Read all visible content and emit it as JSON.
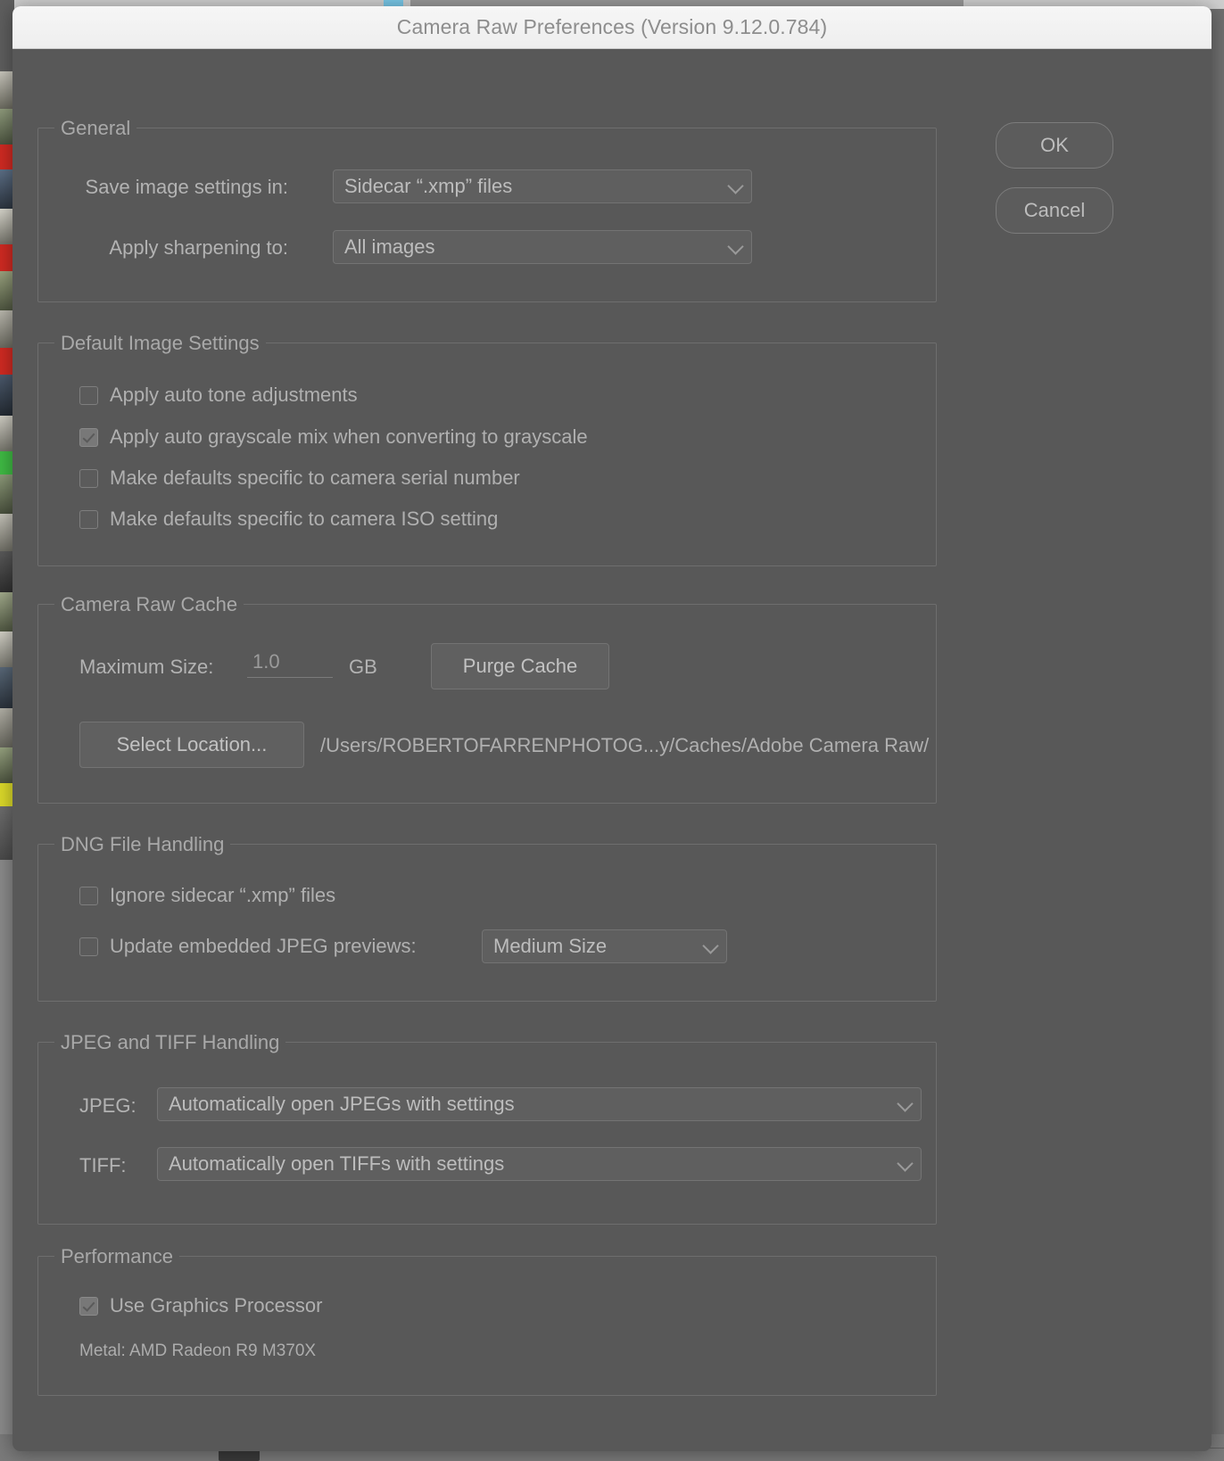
{
  "window": {
    "title": "Camera Raw Preferences  (Version 9.12.0.784)"
  },
  "actions": {
    "ok_label": "OK",
    "cancel_label": "Cancel"
  },
  "general": {
    "legend": "General",
    "save_settings_label": "Save image settings in:",
    "save_settings_value": "Sidecar “.xmp” files",
    "apply_sharpening_label": "Apply sharpening to:",
    "apply_sharpening_value": "All images"
  },
  "default_image_settings": {
    "legend": "Default Image Settings",
    "items": [
      {
        "label": "Apply auto tone adjustments",
        "checked": false
      },
      {
        "label": "Apply auto grayscale mix when converting to grayscale",
        "checked": true
      },
      {
        "label": "Make defaults specific to camera serial number",
        "checked": false
      },
      {
        "label": "Make defaults specific to camera ISO setting",
        "checked": false
      }
    ]
  },
  "camera_raw_cache": {
    "legend": "Camera Raw Cache",
    "max_size_label": "Maximum Size:",
    "max_size_value": "1.0",
    "units_label": "GB",
    "purge_label": "Purge Cache",
    "select_location_label": "Select Location...",
    "cache_path": "/Users/ROBERTOFARRENPHOTOG...y/Caches/Adobe Camera Raw/"
  },
  "dng_file_handling": {
    "legend": "DNG File Handling",
    "ignore_sidecar_label": "Ignore sidecar “.xmp” files",
    "ignore_sidecar_checked": false,
    "update_previews_label": "Update embedded JPEG previews:",
    "update_previews_checked": false,
    "preview_size_value": "Medium Size"
  },
  "jpeg_tiff_handling": {
    "legend": "JPEG and TIFF Handling",
    "jpeg_label": "JPEG:",
    "jpeg_value": "Automatically open JPEGs with settings",
    "tiff_label": "TIFF:",
    "tiff_value": "Automatically open TIFFs with settings"
  },
  "performance": {
    "legend": "Performance",
    "use_gpu_label": "Use Graphics Processor",
    "use_gpu_checked": true,
    "gpu_info": "Metal: AMD Radeon R9 M370X"
  },
  "colors": {
    "dialog_bg": "#585858",
    "titlebar_bg": "#f2f2f2",
    "text": "#b0b0b0",
    "border": "#6e6e6e"
  }
}
